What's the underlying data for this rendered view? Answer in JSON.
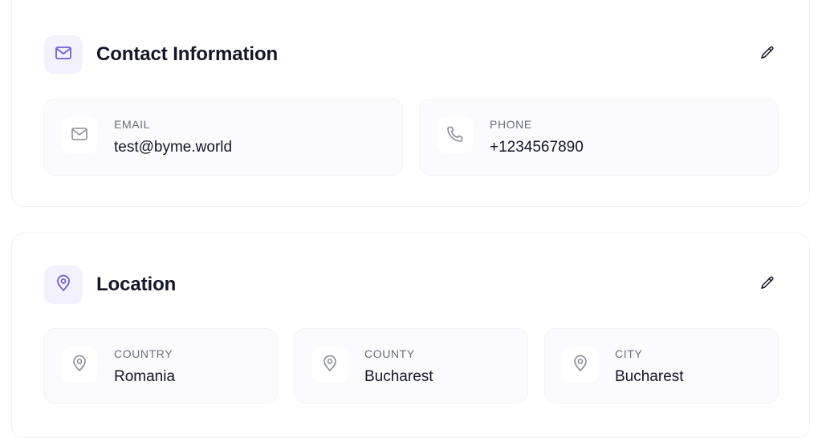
{
  "colors": {
    "accent": "#6f5fd6",
    "icon_bg": "#f3f1fc",
    "field_bg": "#fbfbfd",
    "text_primary": "#141526",
    "text_muted": "#6b6e7c"
  },
  "contact": {
    "title": "Contact Information",
    "header_icon": "mail-icon",
    "edit_icon": "pencil-icon",
    "fields": [
      {
        "label": "EMAIL",
        "value": "test@byme.world",
        "icon": "mail-icon"
      },
      {
        "label": "PHONE",
        "value": "+1234567890",
        "icon": "phone-icon"
      }
    ]
  },
  "location": {
    "title": "Location",
    "header_icon": "map-pin-icon",
    "edit_icon": "pencil-icon",
    "fields": [
      {
        "label": "COUNTRY",
        "value": "Romania",
        "icon": "map-pin-icon"
      },
      {
        "label": "COUNTY",
        "value": "Bucharest",
        "icon": "map-pin-icon"
      },
      {
        "label": "CITY",
        "value": "Bucharest",
        "icon": "map-pin-icon"
      }
    ]
  }
}
